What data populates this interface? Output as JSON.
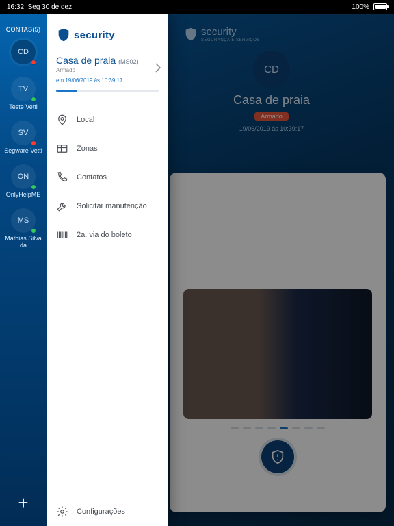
{
  "statusbar": {
    "time": "16:32",
    "date": "Seg 30 de dez",
    "battery": "100%"
  },
  "rail": {
    "label": "CONTAS",
    "count": "(5)",
    "accounts": [
      {
        "initials": "CD",
        "name": "",
        "status": "red",
        "active": true
      },
      {
        "initials": "TV",
        "name": "Teste Vetti",
        "status": "green"
      },
      {
        "initials": "SV",
        "name": "Segware Vetti",
        "status": "red"
      },
      {
        "initials": "ON",
        "name": "OnlyHelpME",
        "status": "green"
      },
      {
        "initials": "MS",
        "name": "Mathias Silva da",
        "status": "green"
      }
    ]
  },
  "logo": {
    "text": "security",
    "tag": "SEGURANÇA E SERVIÇOS"
  },
  "drawer": {
    "title": "Casa de praia",
    "code": "(MS02)",
    "status": "Armado",
    "timestamp": "em 19/06/2019 às 10:39:17",
    "menu": [
      {
        "label": "Local"
      },
      {
        "label": "Zonas"
      },
      {
        "label": "Contatos"
      },
      {
        "label": "Solicitar manutenção"
      },
      {
        "label": "2a. via do boleto"
      }
    ],
    "settings": "Configurações"
  },
  "main": {
    "avatar": "CD",
    "title": "Casa de praia",
    "badge": "Armado",
    "timestamp": "19/06/2019 às 10:39:17"
  }
}
